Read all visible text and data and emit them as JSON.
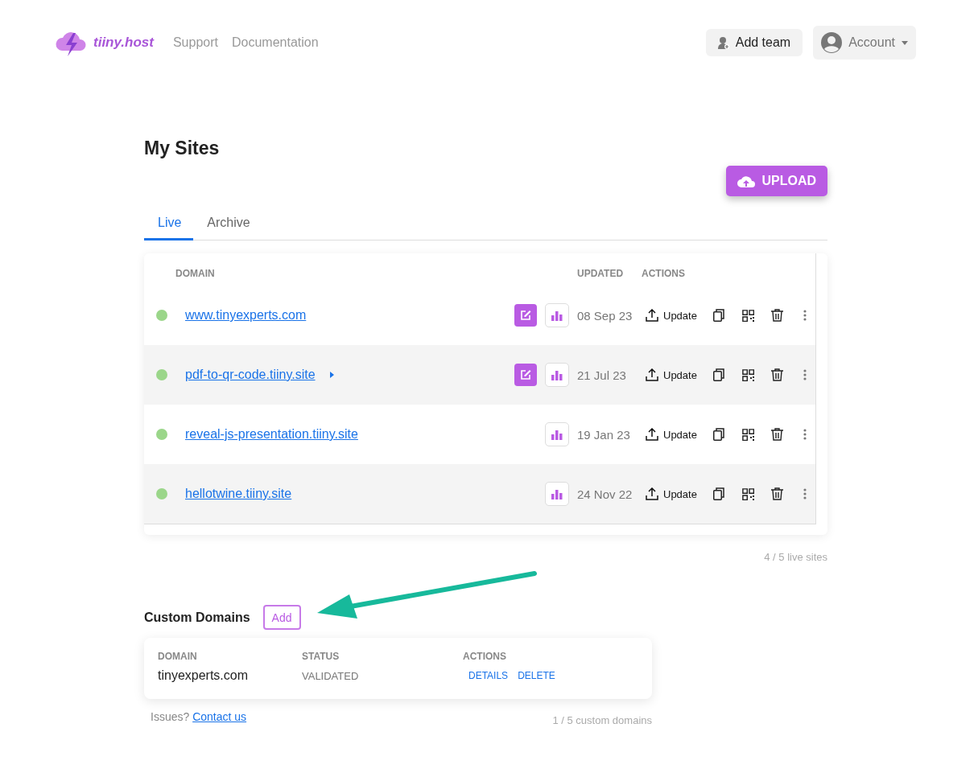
{
  "header": {
    "brand": "tiiny.host",
    "nav": [
      "Support",
      "Documentation"
    ],
    "add_team": "Add team",
    "account": "Account"
  },
  "sites": {
    "title": "My Sites",
    "upload": "UPLOAD",
    "tabs": [
      {
        "label": "Live",
        "selected": true
      },
      {
        "label": "Archive",
        "selected": false
      }
    ],
    "columns": [
      "DOMAIN",
      "UPDATED",
      "ACTIONS"
    ],
    "rows": [
      {
        "domain": "www.tinyexperts.com",
        "color": "#9bd68a",
        "editable": true,
        "expandable": false,
        "updated": "08 Sep 23",
        "update": "Update"
      },
      {
        "domain": "pdf-to-qr-code.tiiny.site",
        "color": "#9bd68a",
        "editable": true,
        "expandable": true,
        "updated": "21 Jul 23",
        "update": "Update"
      },
      {
        "domain": "reveal-js-presentation.tiiny.site",
        "color": "#9bd68a",
        "editable": false,
        "expandable": false,
        "updated": "19 Jan 23",
        "update": "Update"
      },
      {
        "domain": "hellotwine.tiiny.site",
        "color": "#9bd68a",
        "editable": false,
        "expandable": false,
        "updated": "24 Nov 22",
        "update": "Update"
      }
    ],
    "count": "4 / 5 live sites"
  },
  "custom_domains": {
    "title": "Custom Domains",
    "add": "Add",
    "columns": [
      "DOMAIN",
      "STATUS",
      "ACTIONS"
    ],
    "rows": [
      {
        "domain": "tinyexperts.com",
        "status": "VALIDATED",
        "actions": [
          "DETAILS",
          "DELETE"
        ]
      }
    ],
    "issues": "Issues?",
    "contact": "Contact us",
    "count": "1 / 5 custom domains"
  }
}
